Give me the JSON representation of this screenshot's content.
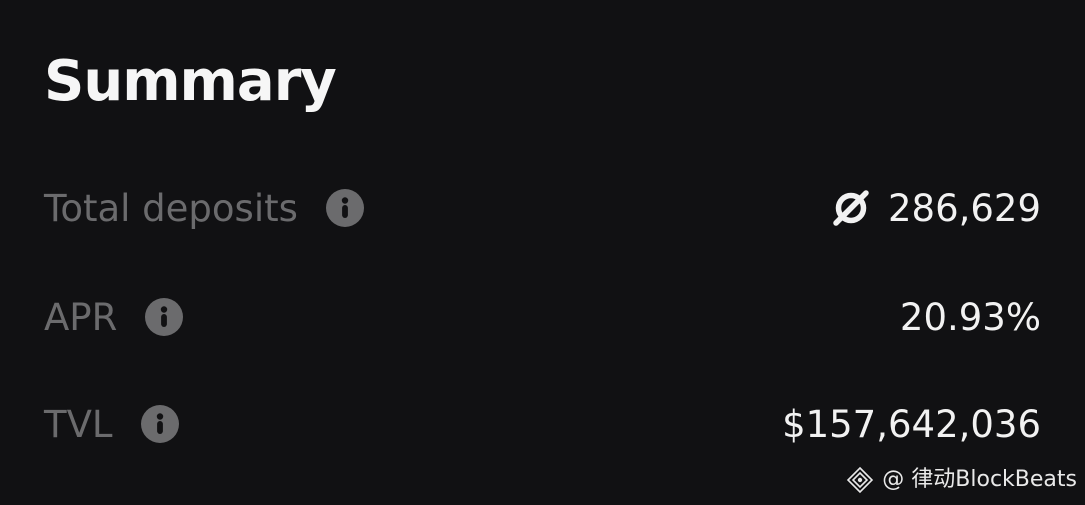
{
  "summary": {
    "title": "Summary",
    "rows": [
      {
        "label": "Total deposits",
        "value": "286,629",
        "label_icon": "info-icon",
        "value_icon": "token-icon"
      },
      {
        "label": "APR",
        "value": "20.93%",
        "label_icon": "info-icon"
      },
      {
        "label": "TVL",
        "value": "$157,642,036",
        "label_icon": "info-icon"
      }
    ]
  },
  "watermark": {
    "text": "@ 律动BlockBeats",
    "icon": "blockbeats-logo-icon"
  },
  "colors": {
    "background": "#111113",
    "title": "#f6f6f6",
    "label": "#6b6b6d",
    "value": "#f2f2f2",
    "info_icon": "#6b6b6d"
  }
}
